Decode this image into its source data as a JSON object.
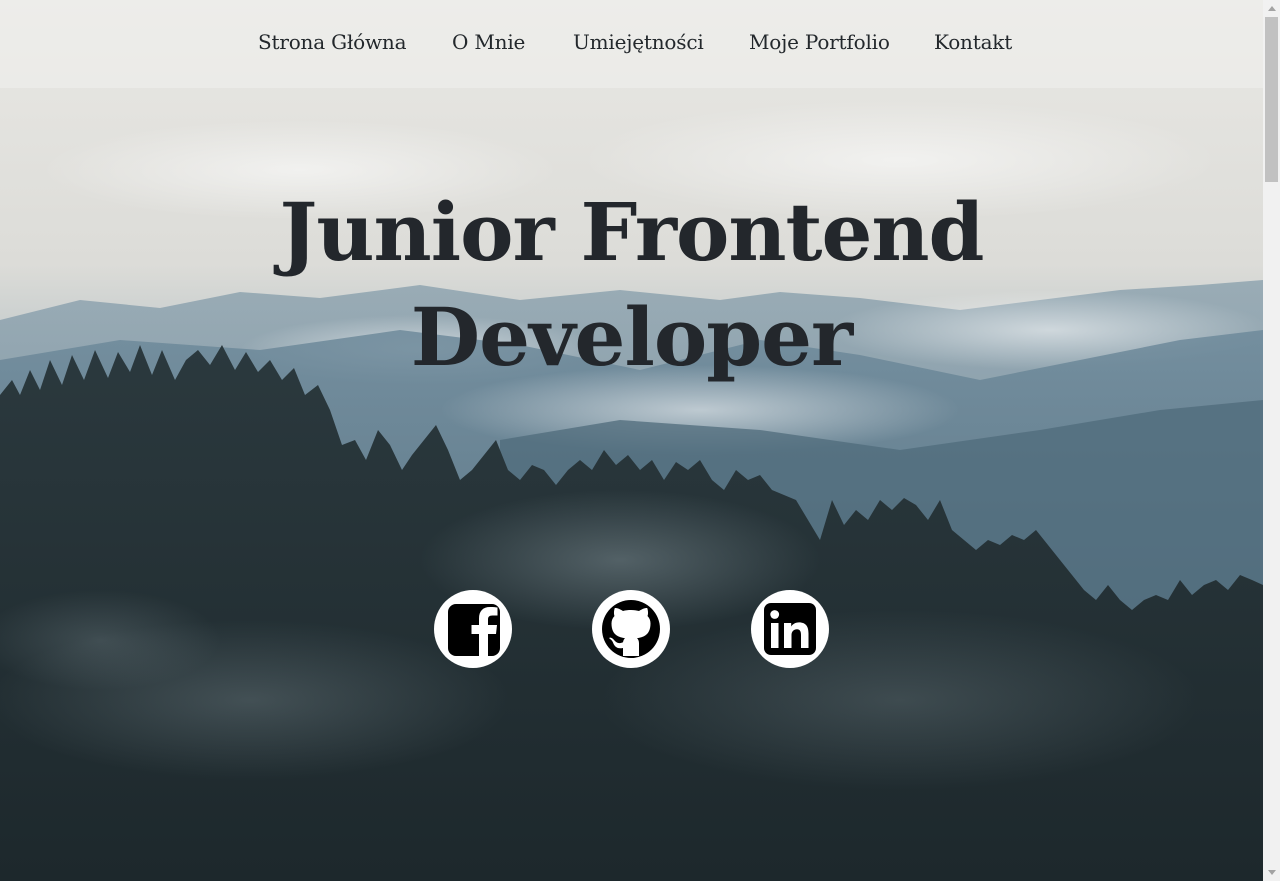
{
  "nav": {
    "items": [
      {
        "label": "Strona Główna"
      },
      {
        "label": "O Mnie"
      },
      {
        "label": "Umiejętności"
      },
      {
        "label": "Moje Portfolio"
      },
      {
        "label": "Kontakt"
      }
    ]
  },
  "hero": {
    "title_line1": "Junior Frontend",
    "title_line2": "Developer"
  },
  "social": [
    {
      "icon": "facebook-icon"
    },
    {
      "icon": "github-icon"
    },
    {
      "icon": "linkedin-icon"
    }
  ],
  "colors": {
    "text": "#23272c",
    "icon_bg": "#ffffff",
    "icon_fg": "#000000"
  }
}
